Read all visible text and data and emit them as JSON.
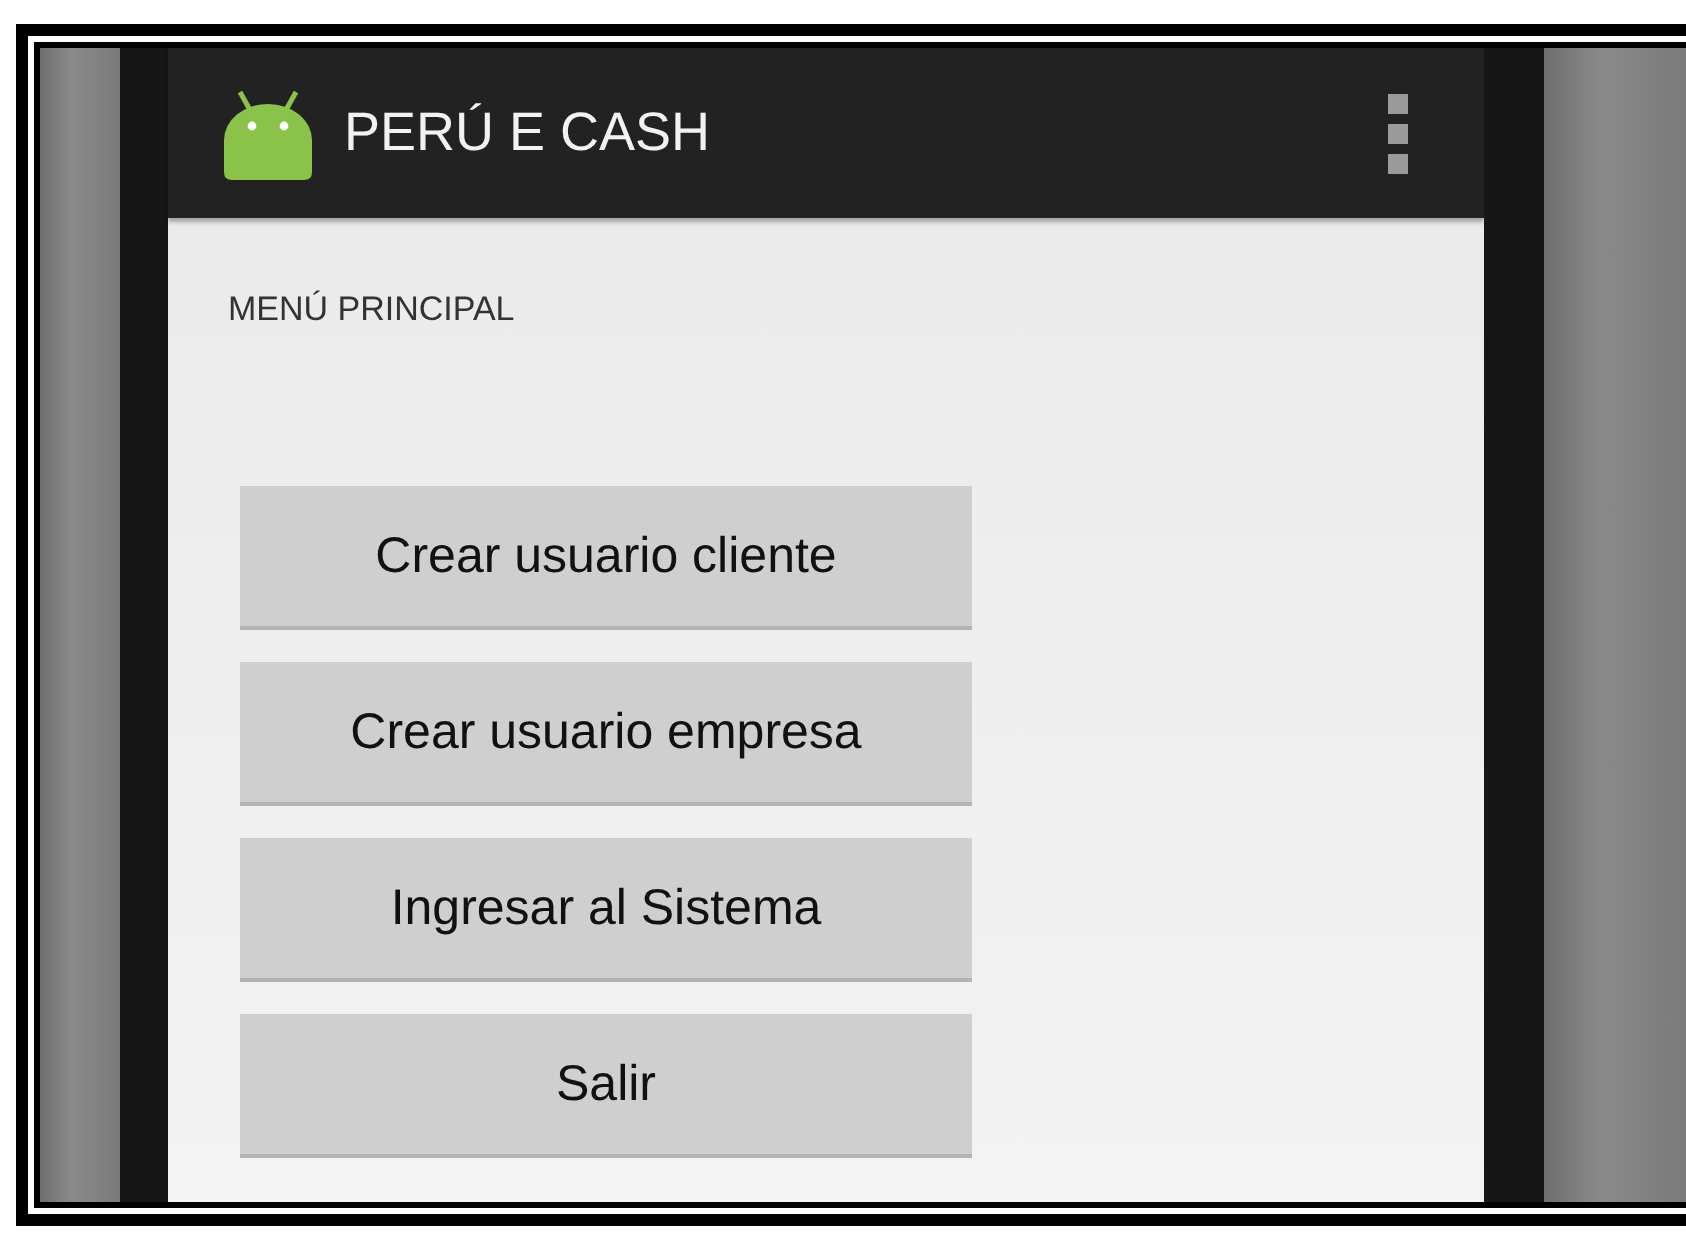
{
  "action_bar": {
    "title": "PERÚ E CASH"
  },
  "screen": {
    "heading": "MENÚ PRINCIPAL"
  },
  "buttons": [
    {
      "label": "Crear usuario cliente"
    },
    {
      "label": "Crear usuario empresa"
    },
    {
      "label": "Ingresar al Sistema"
    },
    {
      "label": "Salir"
    }
  ]
}
